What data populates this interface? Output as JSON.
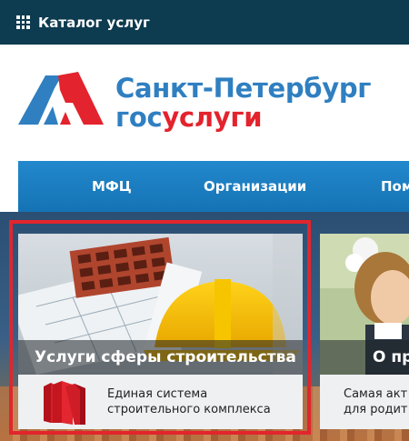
{
  "topbar": {
    "catalog_label": "Каталог услуг"
  },
  "logo": {
    "city": "Санкт-Петербург",
    "service_part1": "гос",
    "service_part2": "услуги"
  },
  "nav": {
    "items": [
      {
        "label": "МФЦ"
      },
      {
        "label": "Организации"
      },
      {
        "label": "Пом"
      }
    ]
  },
  "cards": [
    {
      "title": "Услуги сферы строительства",
      "desc_line1": "Единая система",
      "desc_line2": "строительного комплекса"
    },
    {
      "title": "О пр",
      "desc_line1": "Самая акт",
      "desc_line2": "для родит"
    }
  ],
  "colors": {
    "topbar": "#0d3b50",
    "brand_blue": "#2f7fc1",
    "brand_red": "#e3232d",
    "nav_blue": "#1a7ec3",
    "highlight_frame": "#e2252c"
  },
  "icons": {
    "catalog": "grid-icon",
    "logo": "gosuslugi-logo-icon",
    "eisk": "building-blocks-icon"
  }
}
